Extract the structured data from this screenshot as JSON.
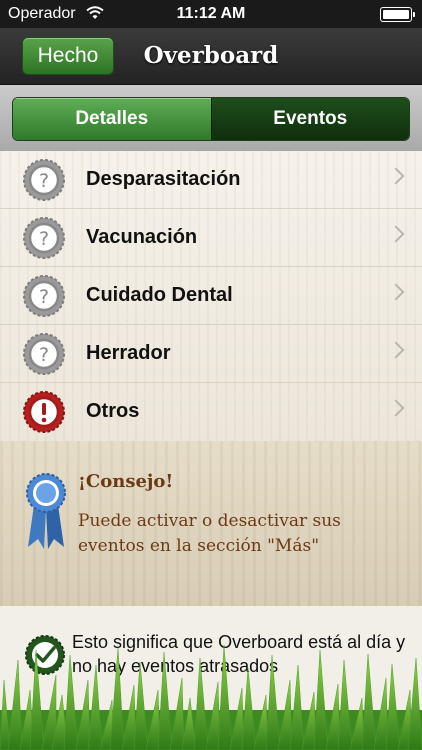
{
  "status_bar": {
    "carrier": "Operador",
    "time": "11:12 AM"
  },
  "nav": {
    "done_label": "Hecho",
    "title": "Overboard"
  },
  "segments": {
    "left": "Detalles",
    "right": "Eventos",
    "selected": "Detalles"
  },
  "events": [
    {
      "label": "Desparasitación",
      "status": "unknown",
      "icon": "question-badge-icon"
    },
    {
      "label": "Vacunación",
      "status": "unknown",
      "icon": "question-badge-icon"
    },
    {
      "label": "Cuidado Dental",
      "status": "unknown",
      "icon": "question-badge-icon"
    },
    {
      "label": "Herrador",
      "status": "unknown",
      "icon": "question-badge-icon"
    },
    {
      "label": "Otros",
      "status": "overdue",
      "icon": "alert-badge-icon"
    }
  ],
  "tip": {
    "title": "¡Consejo!",
    "body": "Puede activar o desactivar sus eventos en la sección \"Más\"",
    "icon": "award-ribbon-icon"
  },
  "footer": {
    "text": "Esto significa que Overboard está al día y no hay eventos atrasados",
    "icon": "check-badge-icon"
  },
  "colors": {
    "accent_green": "#3a8a30",
    "dark_green": "#14380f",
    "alert_red": "#a51a1a",
    "neutral_badge": "#8d8d8d",
    "tip_text": "#6b3a14"
  }
}
